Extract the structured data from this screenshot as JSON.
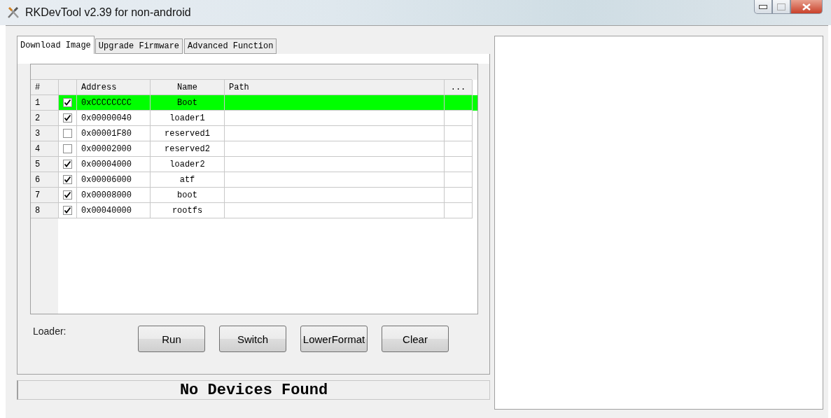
{
  "window": {
    "title": "RKDevTool v2.39 for non-android"
  },
  "tabs": [
    {
      "label": "Download Image",
      "selected": true
    },
    {
      "label": "Upgrade Firmware",
      "selected": false
    },
    {
      "label": "Advanced Function",
      "selected": false
    }
  ],
  "table": {
    "columns": [
      "#",
      "Address",
      "Name",
      "Path",
      "..."
    ],
    "rows": [
      {
        "index": "1",
        "checked": true,
        "selected": true,
        "address": "0xCCCCCCCC",
        "name": "Boot"
      },
      {
        "index": "2",
        "checked": true,
        "selected": false,
        "address": "0x00000040",
        "name": "loader1"
      },
      {
        "index": "3",
        "checked": false,
        "selected": false,
        "address": "0x00001F80",
        "name": "reserved1"
      },
      {
        "index": "4",
        "checked": false,
        "selected": false,
        "address": "0x00002000",
        "name": "reserved2"
      },
      {
        "index": "5",
        "checked": true,
        "selected": false,
        "address": "0x00004000",
        "name": "loader2"
      },
      {
        "index": "6",
        "checked": true,
        "selected": false,
        "address": "0x00006000",
        "name": "atf"
      },
      {
        "index": "7",
        "checked": true,
        "selected": false,
        "address": "0x00008000",
        "name": "boot"
      },
      {
        "index": "8",
        "checked": true,
        "selected": false,
        "address": "0x00040000",
        "name": "rootfs"
      }
    ]
  },
  "loader_label": "Loader:",
  "buttons": [
    "Run",
    "Switch",
    "LowerFormat",
    "Clear"
  ],
  "status_bar": "No Devices Found"
}
